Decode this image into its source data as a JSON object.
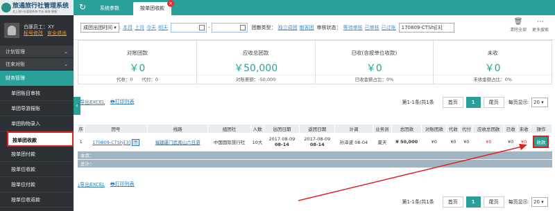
{
  "app": {
    "logo_title": "旅通旅行社管理系统",
    "logo_sub": "北上旅行社管理系统·专业·高效·便捷"
  },
  "user": {
    "line1": "白豚员工：XY",
    "link1": "标号修改",
    "link2": "安全退出"
  },
  "nav": {
    "plan": "计划管理",
    "travel": "往来对账",
    "finance": "财务管理",
    "subs": [
      "单团账目审核",
      "单团导游报账",
      "单团购物录入",
      "按单团收款",
      "按单团付款",
      "按单位收款",
      "按单位付款",
      "按单位收返款"
    ]
  },
  "tabs": [
    "系统参数",
    "按单团收款"
  ],
  "filter": {
    "mode": "成团出团时间",
    "colon": ":",
    "l1": "本月",
    "l2": "上月",
    "l3": "今天",
    "l4": "明天",
    "sep": "-",
    "type_label": "团散类型：",
    "t1": "独立成团",
    "t2": "散客团",
    "audit_label": "审核状态：",
    "a1": "等待审核",
    "a2": "已审核",
    "a3": "已过账",
    "keyword": "170809-CTShj[3]",
    "clear": "清除全部",
    "more": "更多搜索"
  },
  "stats": [
    {
      "label": "对账团款",
      "value": "￥0",
      "sub": "代收：0　　代付：0"
    },
    {
      "label": "应收总团款",
      "value": "￥50,000",
      "sub": "对账差额：-50,000"
    },
    {
      "label": "已收(含按单位收款)",
      "value": "￥0",
      "sub": "已收金额占比：0%"
    },
    {
      "label": "未收",
      "value": "￥0",
      "sub": "未收金额占比：0%"
    }
  ],
  "toolbar": {
    "export": "导出EXCEL",
    "print": "打印列表",
    "info": "第1-1条/共1条",
    "first": "首页",
    "page": "1",
    "last": "尾页",
    "per_page": "每页显示:",
    "size": "20"
  },
  "table": {
    "headers": [
      "序",
      "团号",
      "线路",
      "组团社",
      "人数",
      "出团日期",
      "返团日期",
      "计调",
      "业务员",
      "总团款",
      "对账团款",
      "代收",
      "代付",
      "应收总团款",
      "已收",
      "未收",
      "操作"
    ],
    "row": {
      "idx": "1",
      "code": "170809-CTShj[3]",
      "badge": "团",
      "route": "福建厦门武夷山六日游",
      "agency": "中国国际旅行社",
      "people": "10大",
      "start_y": "2017-08-09",
      "start_d": "08-14",
      "end_y": "2017-08-09",
      "end_d": "08-14",
      "planner": "孙泽波 08-04",
      "sales": "夏天",
      "total": "¥ 50,000",
      "acct": "¥0",
      "coll": "¥0",
      "pay": "¥0",
      "due": "¥0",
      "recv": "¥0",
      "unrecv": "¥0",
      "op": "收款"
    },
    "page_total": "本页：",
    "total": "总计："
  }
}
